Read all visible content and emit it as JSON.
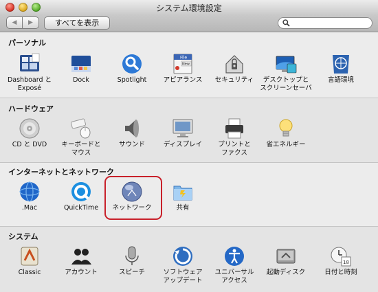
{
  "window": {
    "title": "システム環境設定"
  },
  "toolbar": {
    "back_label": "◀",
    "forward_label": "▶",
    "show_all_label": "すべてを表示",
    "search_value": ""
  },
  "sections": [
    {
      "title": "パーソナル",
      "items": [
        {
          "label": "Dashboard と\nExposé",
          "icon": "dashboard-expose-icon"
        },
        {
          "label": "Dock",
          "icon": "dock-icon"
        },
        {
          "label": "Spotlight",
          "icon": "spotlight-icon"
        },
        {
          "label": "アピアランス",
          "icon": "appearance-icon"
        },
        {
          "label": "セキュリティ",
          "icon": "security-icon"
        },
        {
          "label": "デスクトップと\nスクリーンセーバ",
          "icon": "desktop-screensaver-icon"
        },
        {
          "label": "言語環境",
          "icon": "international-icon"
        }
      ]
    },
    {
      "title": "ハードウェア",
      "items": [
        {
          "label": "CD と DVD",
          "icon": "cd-dvd-icon"
        },
        {
          "label": "キーボードと\nマウス",
          "icon": "keyboard-mouse-icon"
        },
        {
          "label": "サウンド",
          "icon": "sound-icon"
        },
        {
          "label": "ディスプレイ",
          "icon": "display-icon"
        },
        {
          "label": "プリントと\nファクス",
          "icon": "print-fax-icon"
        },
        {
          "label": "省エネルギー",
          "icon": "energy-saver-icon"
        }
      ]
    },
    {
      "title": "インターネットとネットワーク",
      "items": [
        {
          "label": ".Mac",
          "icon": "dotmac-icon"
        },
        {
          "label": "QuickTime",
          "icon": "quicktime-icon"
        },
        {
          "label": "ネットワーク",
          "icon": "network-icon"
        },
        {
          "label": "共有",
          "icon": "sharing-icon"
        }
      ]
    },
    {
      "title": "システム",
      "items": [
        {
          "label": "Classic",
          "icon": "classic-icon"
        },
        {
          "label": "アカウント",
          "icon": "accounts-icon"
        },
        {
          "label": "スピーチ",
          "icon": "speech-icon"
        },
        {
          "label": "ソフトウェア\nアップデート",
          "icon": "software-update-icon"
        },
        {
          "label": "ユニバーサル\nアクセス",
          "icon": "universal-access-icon"
        },
        {
          "label": "起動ディスク",
          "icon": "startup-disk-icon"
        },
        {
          "label": "日付と時刻",
          "icon": "date-time-icon"
        }
      ]
    }
  ],
  "icon_content": {
    "appearance_file": "File",
    "appearance_new": "New",
    "date_day": "18"
  },
  "colors": {
    "highlight": "#c8202a"
  }
}
